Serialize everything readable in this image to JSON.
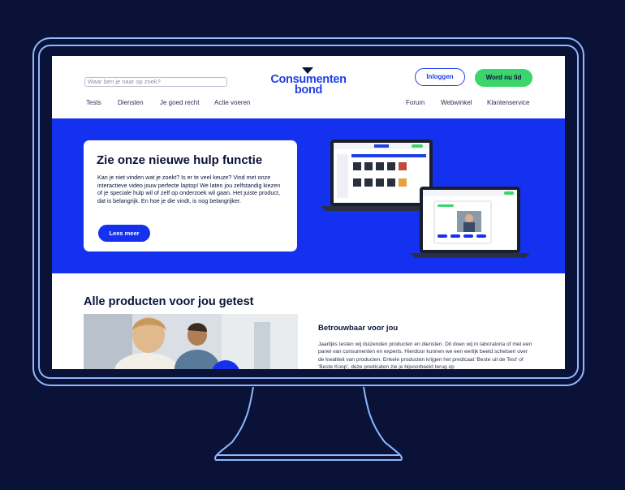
{
  "header": {
    "search_placeholder": "Waar ben je naar op zoek?",
    "logo_line1": "Consumenten",
    "logo_line2": "bond",
    "login_label": "Inloggen",
    "member_label": "Word nu lid"
  },
  "nav_left": [
    "Tests",
    "Diensten",
    "Je goed recht",
    "Actie voeren"
  ],
  "nav_right": [
    "Forum",
    "Webwinkel",
    "Klantenservice"
  ],
  "hero": {
    "title": "Zie onze nieuwe hulp functie",
    "text": "Kan je niet vinden wat je zoekt? Is er te veel keuze? Vind met onze interactieve video jouw perfecte laptop! We laten jou zelfstandig kiezen of je speciale hulp wil of zelf op onderzoek wil gaan. Het juiste product, dat is belangrijk. En hoe je die vindt, is nog belangrijker.",
    "button_label": "Lees meer"
  },
  "products": {
    "title": "Alle producten voor jou getest",
    "trust_title": "Betrouwbaar voor jou",
    "trust_text": "Jaarlijks testen wij duizenden producten en diensten. Dit doen wij in laboratoria of met een panel van consumenten en experts. Hierdoor kunnen we een eerlijk beeld schetsen over de kwaliteit van producten. Enkele producten krijgen het predicaat 'Beste uit de Test' of 'Beste Koop', deze predicaten zie je bijvoorbeeld terug op"
  },
  "colors": {
    "background": "#0a1238",
    "monitor_outline": "#8fb6ff",
    "brand_blue": "#1431f0",
    "brand_green": "#3cd46d"
  }
}
